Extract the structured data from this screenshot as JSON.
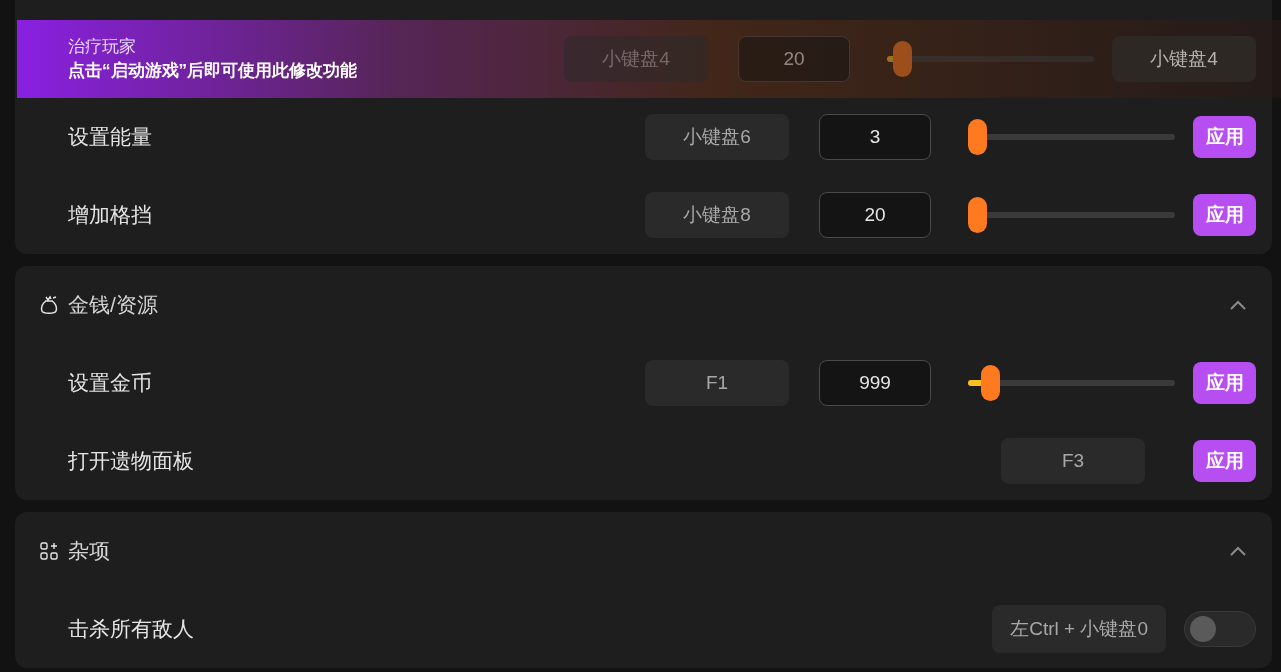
{
  "sections": [
    {
      "rows": [
        {
          "kind": "slider",
          "hotkey": "小键盘4",
          "value": "20",
          "level": 0.03,
          "action": {
            "kind": "key",
            "label": "小键盘4"
          },
          "notice": {
            "title": "治疗玩家",
            "message": "点击“启动游戏”后即可使用此修改功能"
          }
        },
        {
          "kind": "slider",
          "label": "设置能量",
          "hotkey": "小键盘6",
          "value": "3",
          "level": 0,
          "action": {
            "kind": "apply",
            "label": "应用"
          }
        },
        {
          "kind": "slider",
          "label": "增加格挡",
          "hotkey": "小键盘8",
          "value": "20",
          "level": 0,
          "action": {
            "kind": "apply",
            "label": "应用"
          }
        }
      ]
    },
    {
      "title": "金钱/资源",
      "expanded": true,
      "rows": [
        {
          "kind": "slider",
          "label": "设置金币",
          "hotkey": "F1",
          "value": "999",
          "level": 0.07,
          "action": {
            "kind": "apply",
            "label": "应用"
          }
        },
        {
          "kind": "button",
          "label": "打开遗物面板",
          "hotkey": "F3",
          "action": {
            "kind": "apply",
            "label": "应用"
          }
        }
      ]
    },
    {
      "title": "杂项",
      "expanded": true,
      "rows": [
        {
          "kind": "toggle",
          "label": "击杀所有敌人",
          "hotkey": "左Ctrl + 小键盘0",
          "on": false
        }
      ]
    }
  ]
}
